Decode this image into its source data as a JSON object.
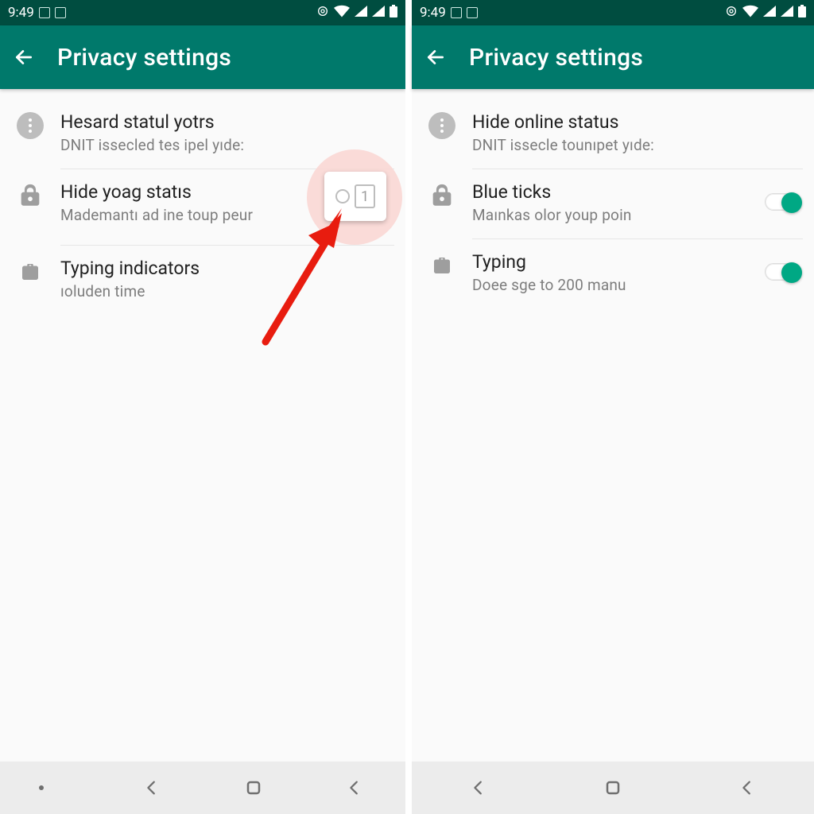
{
  "status_time": "9:49",
  "left": {
    "appbar_title": "Privacy settings",
    "rows": [
      {
        "title": "Hesard statul yotrs",
        "sub": "DNIT issecled tes ipel yıde:"
      },
      {
        "title": "Hide yoag statıs",
        "sub": "Mademantı ad ine toup peur"
      },
      {
        "title": "Typing indicators",
        "sub": "ıoluden time"
      }
    ],
    "checkbox_digit": "1"
  },
  "right": {
    "appbar_title": "Privacy settings",
    "rows": [
      {
        "title": "Hide online status",
        "sub": "DNIT issecle tounıpet yıde:"
      },
      {
        "title": "Blue ticks",
        "sub": "Maınkas olor youp poin"
      },
      {
        "title": "Typing",
        "sub": "Doee sge to 200 manu"
      }
    ]
  }
}
